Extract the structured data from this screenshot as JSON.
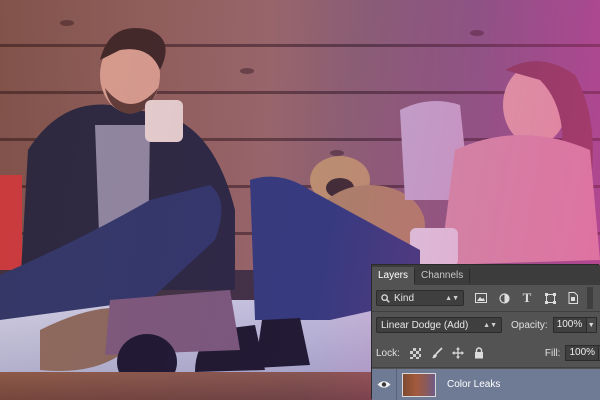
{
  "photo": {
    "description_icon": "photo-couple-with-dog"
  },
  "layers_panel": {
    "tabs": [
      "Layers",
      "Channels"
    ],
    "filter": {
      "label": "Kind",
      "icons": [
        "search-icon",
        "image-filter-icon",
        "adjustment-filter-icon",
        "type-filter-icon",
        "shape-filter-icon",
        "smart-object-filter-icon"
      ]
    },
    "blend_mode": "Linear Dodge (Add)",
    "opacity_label": "Opacity:",
    "opacity_value": "100%",
    "lock_label": "Lock:",
    "lock_icons": [
      "lock-transparent-icon",
      "lock-paint-icon",
      "lock-position-icon",
      "lock-all-icon"
    ],
    "fill_label": "Fill:",
    "fill_value": "100%",
    "layers": [
      {
        "name": "Color Leaks",
        "visible": true,
        "selected": true
      }
    ]
  },
  "colors": {
    "panel_bg": "#535353",
    "tab_bar": "#3c3c3c",
    "selected_layer": "#6f7b95",
    "tint_magenta": "#eb3c96"
  }
}
